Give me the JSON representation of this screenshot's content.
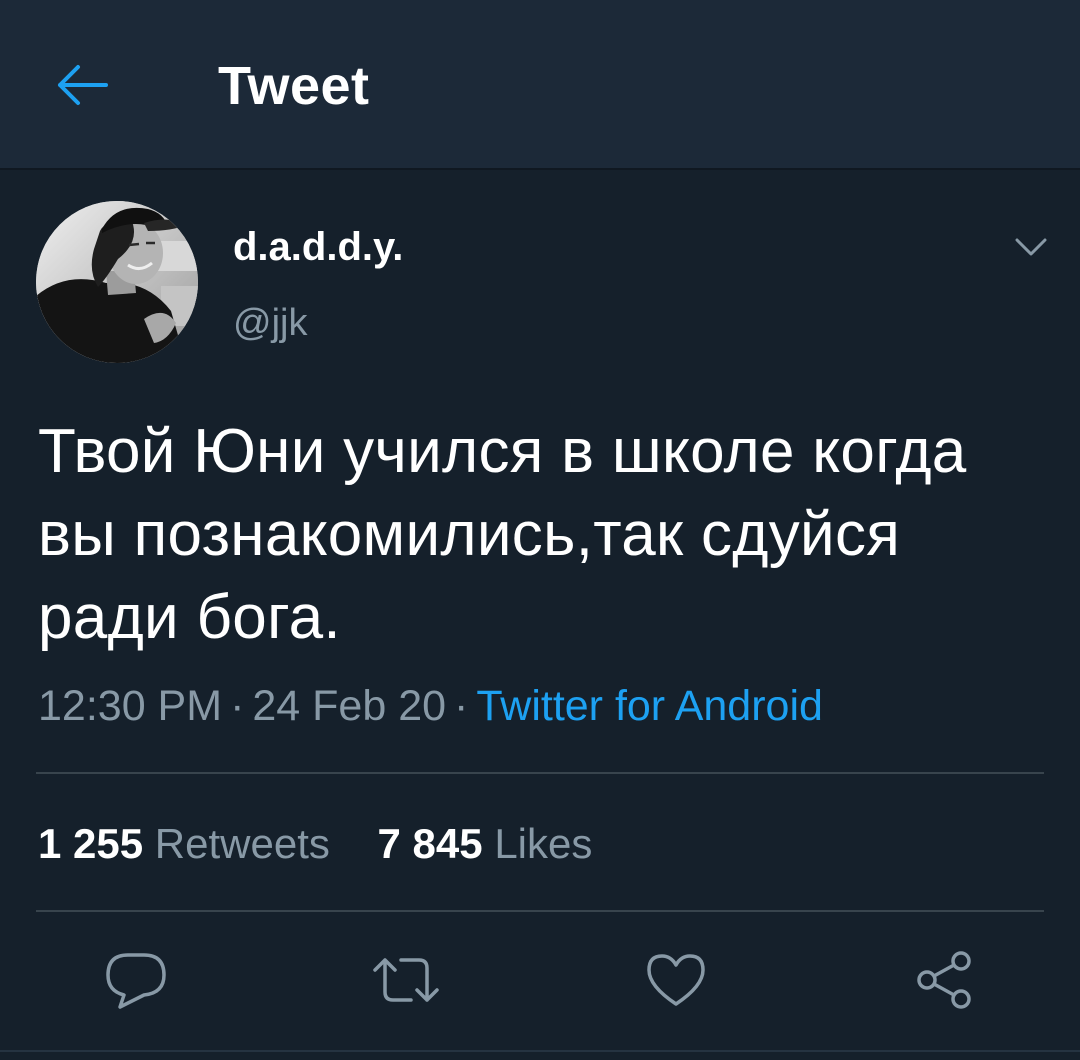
{
  "header": {
    "title": "Tweet",
    "back_icon": "arrow-left-icon",
    "accent_color": "#1da1f2"
  },
  "author": {
    "display_name": "d.a.d.d.y.",
    "handle": "@jjk",
    "avatar": "profile-photo",
    "menu_icon": "chevron-down-icon"
  },
  "tweet": {
    "text": "Твой Юни учился в школе когда вы познакомились,так сдуйся ради бога.",
    "time": "12:30 PM",
    "date": "24 Feb 20",
    "separator": "·",
    "source": "Twitter for Android"
  },
  "stats": {
    "retweets_count": "1 255",
    "retweets_label": "Retweets",
    "likes_count": "7 845",
    "likes_label": "Likes"
  },
  "actions": {
    "reply_icon": "reply-icon",
    "retweet_icon": "retweet-icon",
    "like_icon": "heart-icon",
    "share_icon": "share-icon"
  },
  "theme": {
    "background": "#15202b",
    "header_background": "#1c2938",
    "secondary_text": "#8899a6",
    "divider": "#38444d"
  }
}
